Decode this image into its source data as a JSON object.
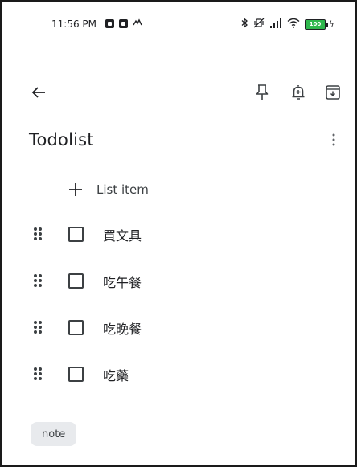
{
  "status_bar": {
    "time": "11:56 PM",
    "left_icons": [
      "app-notification-icon",
      "app-notification-icon",
      "signal-glyph-icon"
    ],
    "right_icons": [
      "bluetooth-icon",
      "vibrate-off-icon",
      "cell-signal-icon",
      "wifi-icon",
      "battery-icon"
    ],
    "battery_level": "100",
    "battery_charging_glyph": "ϟ"
  },
  "toolbar": {
    "back_icon": "arrow-back-icon",
    "pin_icon": "pin-icon",
    "reminder_icon": "add-alert-icon",
    "archive_icon": "archive-icon"
  },
  "note": {
    "title": "Todolist",
    "add_item_label": "List item",
    "items": [
      {
        "text": "買文具",
        "checked": false
      },
      {
        "text": "吃午餐",
        "checked": false
      },
      {
        "text": "吃晚餐",
        "checked": false
      },
      {
        "text": "吃藥",
        "checked": false
      }
    ],
    "label": "note"
  },
  "colors": {
    "text": "#202124",
    "icon": "#3c4043",
    "chip_bg": "#e8eaed",
    "battery_fill": "#2fb84d"
  }
}
